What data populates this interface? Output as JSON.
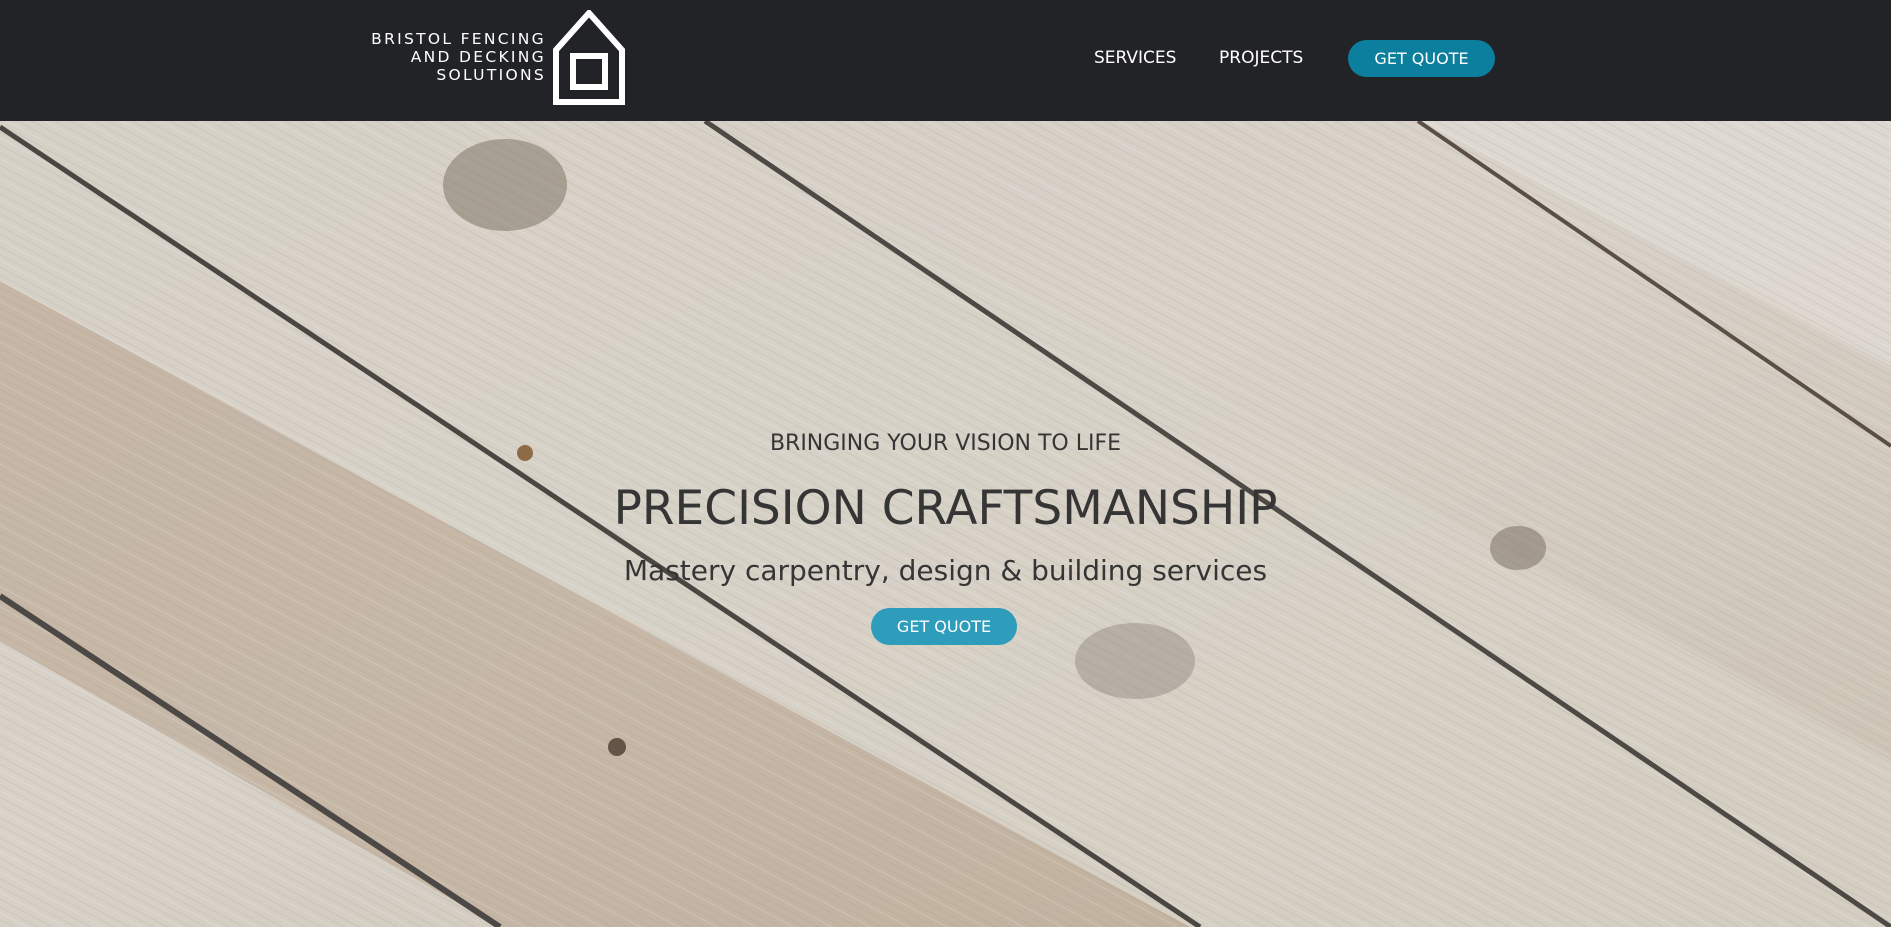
{
  "header": {
    "logo_lines": [
      "BRISTOL FENCING",
      "AND DECKING",
      "SOLUTIONS"
    ],
    "logo_icon": "house-icon",
    "nav": {
      "services_label": "SERVICES",
      "projects_label": "PROJECTS"
    },
    "quote_label": "GET QUOTE"
  },
  "hero": {
    "background": "diagonal weathered wooden planks photograph",
    "eyebrow": "BRINGING YOUR VISION TO LIFE",
    "title": "PRECISION CRAFTSMANSHIP",
    "subtitle": "Mastery carpentry, design & building services",
    "cta_label": "GET QUOTE"
  },
  "colors": {
    "header_bg": "#222327",
    "header_button": "#0b7f9d",
    "hero_button": "#2d9dbb",
    "hero_text": "#353535",
    "nav_text": "#ffffff"
  }
}
